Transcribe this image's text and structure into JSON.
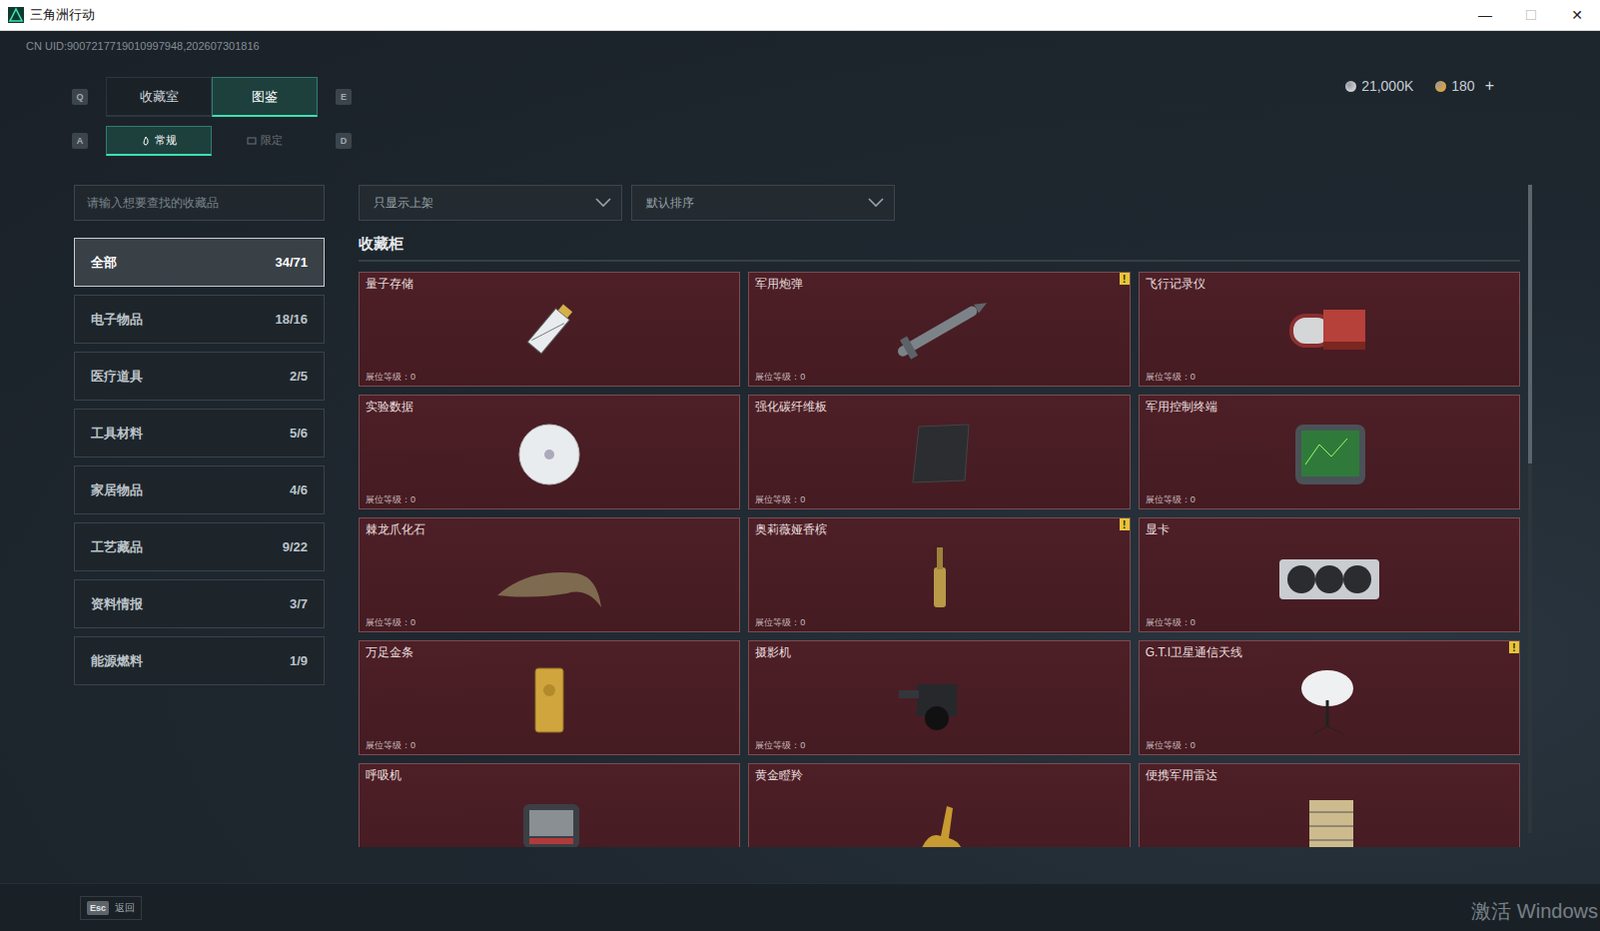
{
  "window": {
    "title": "三角洲行动",
    "controls": [
      {
        "glyph": "—",
        "disabled": false
      },
      {
        "glyph": "☐",
        "disabled": true
      },
      {
        "glyph": "✕",
        "disabled": false
      }
    ]
  },
  "uid": "CN UID:9007217719010997948,202607301816",
  "currency": {
    "items": [
      {
        "amount": "21,000K",
        "color": "#c9cdd1"
      },
      {
        "amount": "180",
        "color": "#d9a441"
      }
    ],
    "add": "+"
  },
  "tabs": {
    "prev_key": "Q",
    "next_key": "E",
    "items": [
      {
        "label": "收藏室",
        "selected": false
      },
      {
        "label": "图鉴",
        "selected": true
      }
    ]
  },
  "subtabs": {
    "prev_key": "A",
    "next_key": "D",
    "items": [
      {
        "label": "常规",
        "selected": true
      },
      {
        "label": "限定",
        "selected": false
      }
    ]
  },
  "search": {
    "placeholder": "请输入想要查找的收藏品"
  },
  "filters": [
    {
      "label": "只显示上架"
    },
    {
      "label": "默认排序"
    }
  ],
  "sidebar": {
    "items": [
      {
        "label": "全部",
        "count": "34/71",
        "selected": true
      },
      {
        "label": "电子物品",
        "count": "18/16",
        "selected": false
      },
      {
        "label": "医疗道具",
        "count": "2/5",
        "selected": false
      },
      {
        "label": "工具材料",
        "count": "5/6",
        "selected": false
      },
      {
        "label": "家居物品",
        "count": "4/6",
        "selected": false
      },
      {
        "label": "工艺藏品",
        "count": "9/22",
        "selected": false
      },
      {
        "label": "资料情报",
        "count": "3/7",
        "selected": false
      },
      {
        "label": "能源燃料",
        "count": "1/9",
        "selected": false
      }
    ]
  },
  "section_title": "收藏柜",
  "alert_mark": "!",
  "cards": [
    {
      "name": "量子存储",
      "booth": "展位等级：0",
      "alert": false
    },
    {
      "name": "军用炮弹",
      "booth": "展位等级：0",
      "alert": true
    },
    {
      "name": "飞行记录仪",
      "booth": "展位等级：0",
      "alert": false
    },
    {
      "name": "实验数据",
      "booth": "展位等级：0",
      "alert": false
    },
    {
      "name": "强化碳纤维板",
      "booth": "展位等级：0",
      "alert": false
    },
    {
      "name": "军用控制终端",
      "booth": "展位等级：0",
      "alert": false
    },
    {
      "name": "棘龙爪化石",
      "booth": "展位等级：0",
      "alert": false
    },
    {
      "name": "奥莉薇娅香槟",
      "booth": "展位等级：0",
      "alert": true
    },
    {
      "name": "显卡",
      "booth": "展位等级：0",
      "alert": false
    },
    {
      "name": "万足金条",
      "booth": "展位等级：0",
      "alert": false
    },
    {
      "name": "摄影机",
      "booth": "展位等级：0",
      "alert": false
    },
    {
      "name": "G.T.I卫星通信天线",
      "booth": "展位等级：0",
      "alert": true
    },
    {
      "name": "呼吸机",
      "alert": false
    },
    {
      "name": "黄金瞪羚",
      "alert": false
    },
    {
      "name": "便携军用雷达",
      "alert": false
    }
  ],
  "scrollbar": {
    "level": 0.43
  },
  "footer": {
    "key": "Esc",
    "label": "返回"
  },
  "watermark": "激活 Windows"
}
